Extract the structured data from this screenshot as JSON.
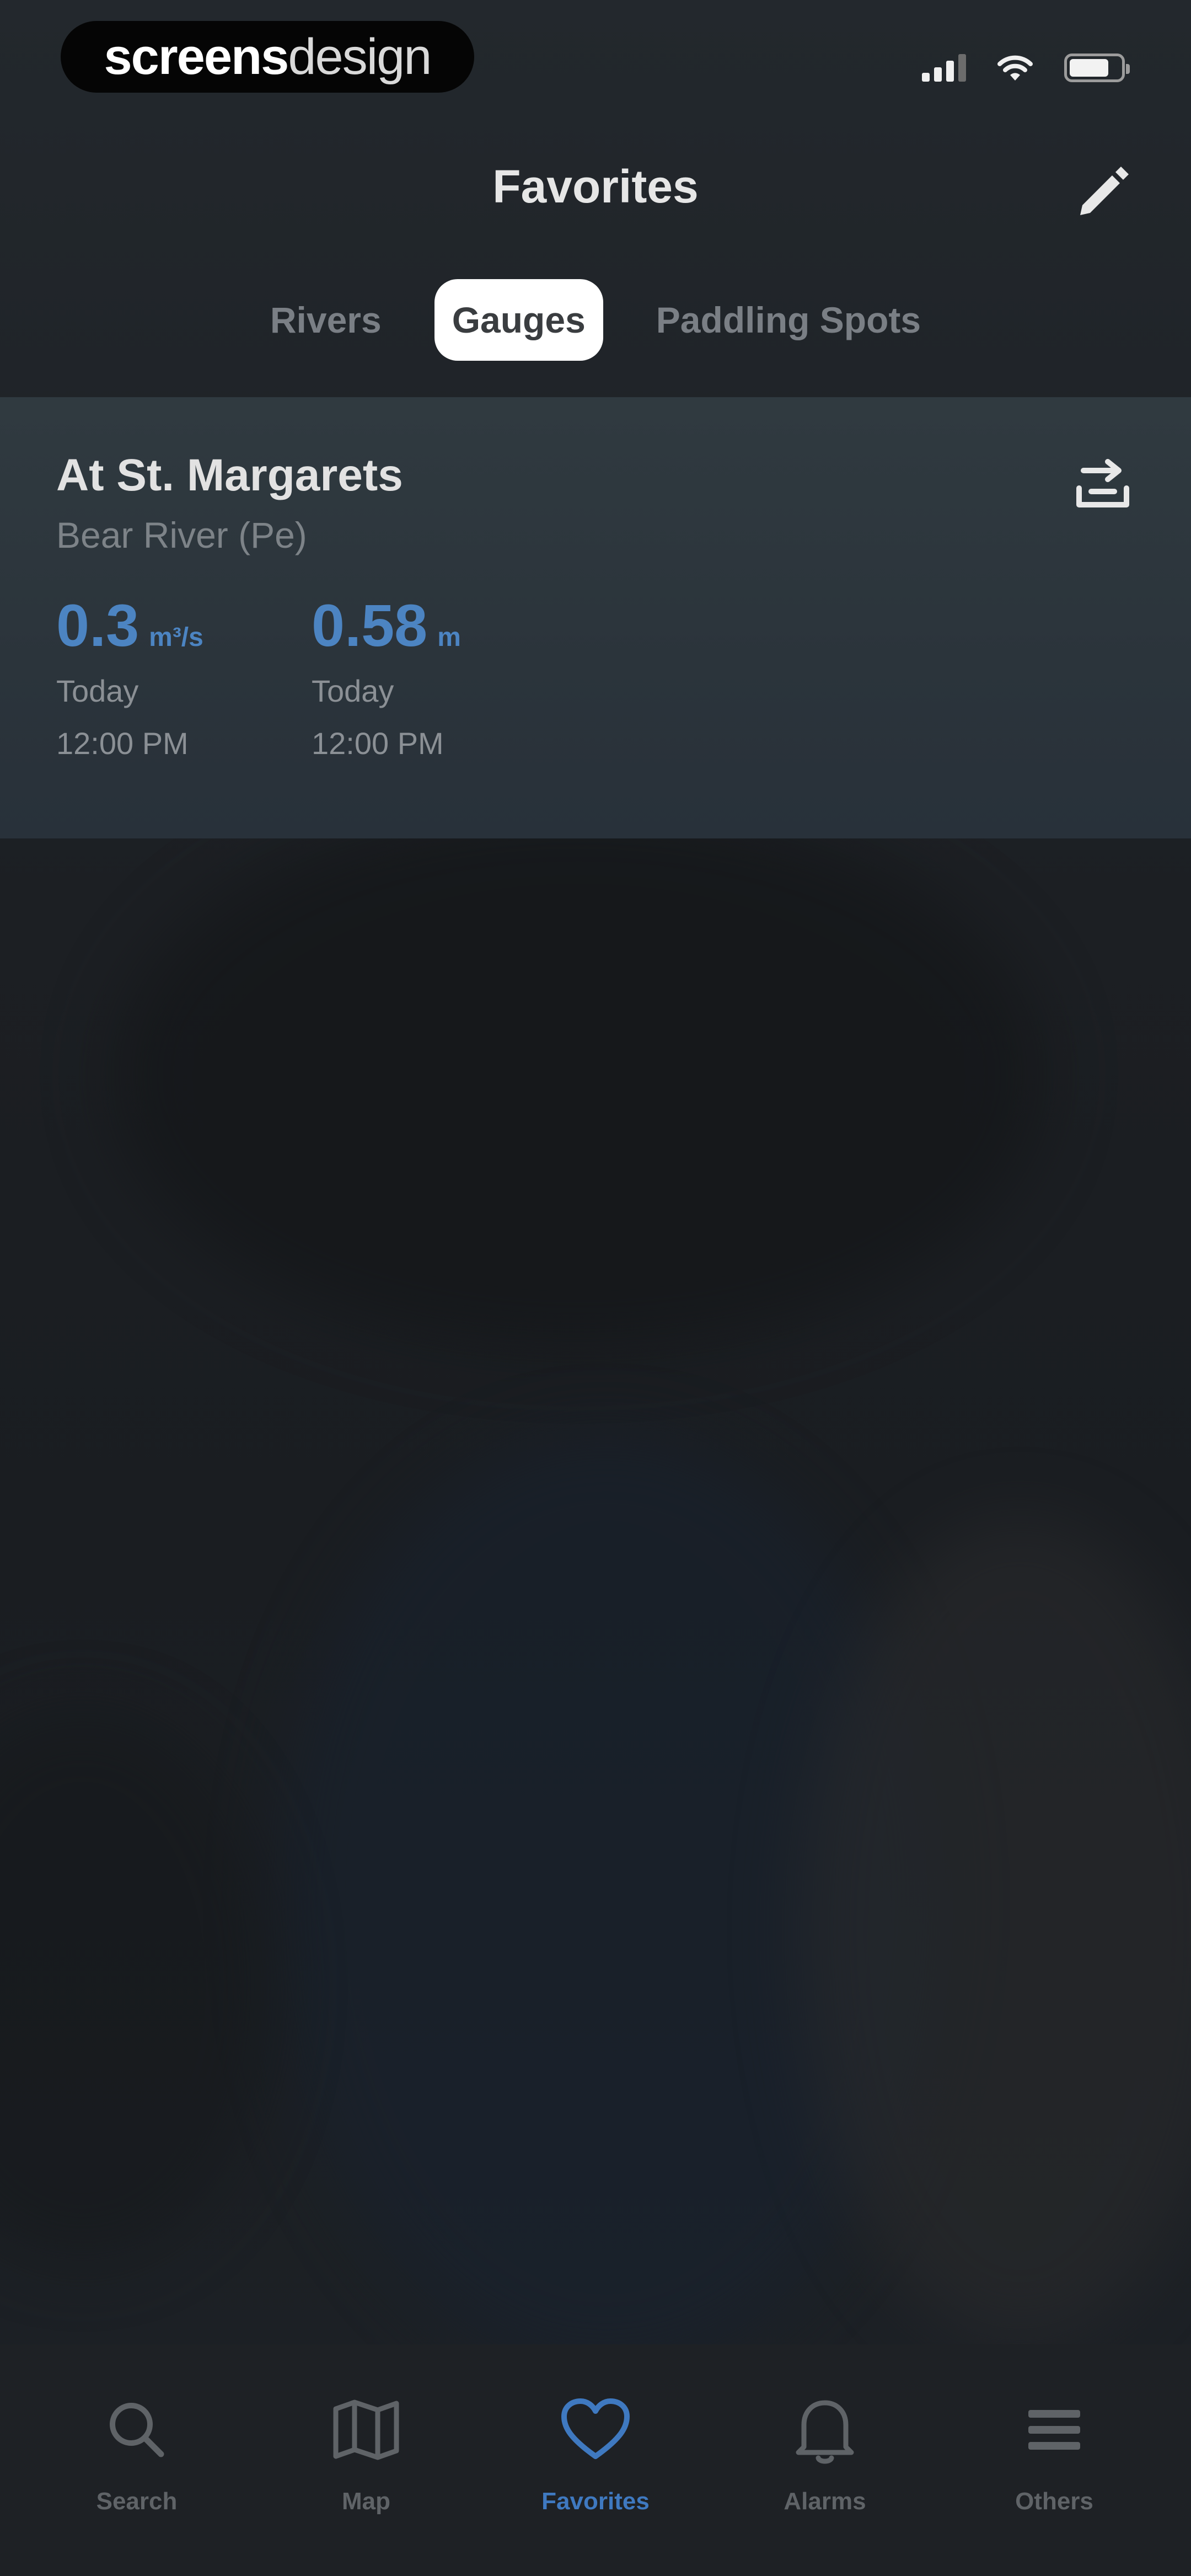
{
  "status_bar": {
    "brand_bold": "screens",
    "brand_light": "design"
  },
  "header": {
    "title": "Favorites"
  },
  "tabs": [
    {
      "label": "Rivers",
      "active": false
    },
    {
      "label": "Gauges",
      "active": true
    },
    {
      "label": "Paddling Spots",
      "active": false
    }
  ],
  "gauge": {
    "title": "At St. Margarets",
    "subtitle": "Bear River (Pe)",
    "readings": [
      {
        "value": "0.3",
        "unit": "m³/s",
        "day": "Today",
        "time": "12:00 PM"
      },
      {
        "value": "0.58",
        "unit": "m",
        "day": "Today",
        "time": "12:00 PM"
      }
    ]
  },
  "tab_bar": [
    {
      "label": "Search",
      "icon": "search-icon",
      "active": false
    },
    {
      "label": "Map",
      "icon": "map-icon",
      "active": false
    },
    {
      "label": "Favorites",
      "icon": "heart-icon",
      "active": true
    },
    {
      "label": "Alarms",
      "icon": "bell-icon",
      "active": false
    },
    {
      "label": "Others",
      "icon": "list-icon",
      "active": false
    }
  ],
  "colors": {
    "accent": "#3f79c0",
    "reading": "#4c84c2",
    "background": "#1b1e22"
  }
}
